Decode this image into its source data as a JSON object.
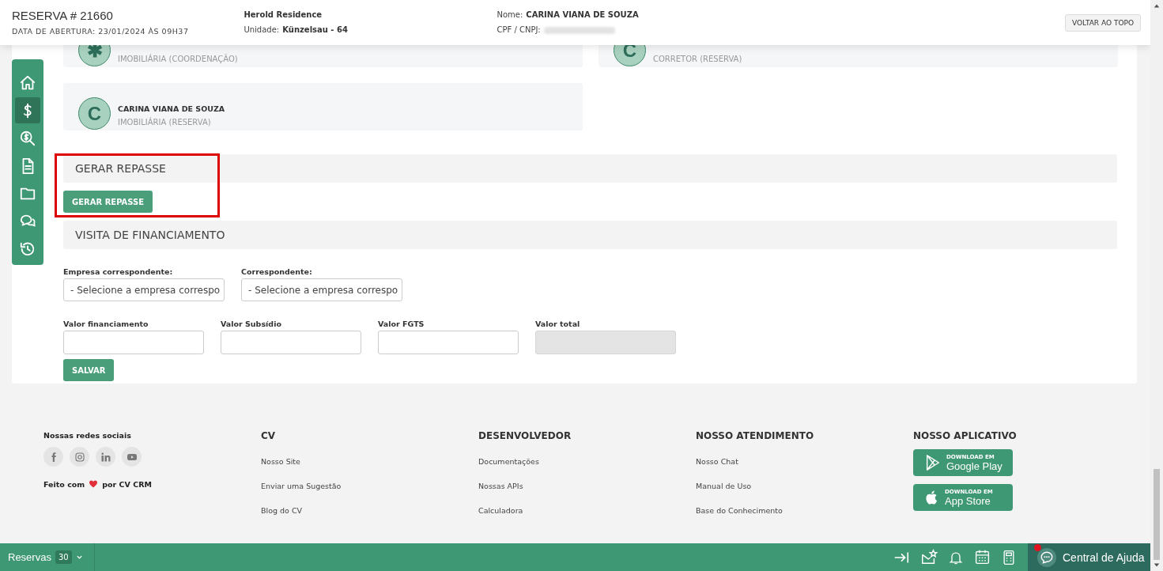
{
  "header": {
    "title": "RESERVA # 21660",
    "opened": "DATA DE ABERTURA: 23/01/2024 ÀS 09H37",
    "project": "Herold Residence",
    "unit_label": "Unidade:",
    "unit": "Künzelsau - 64",
    "name_label": "Nome:",
    "name": "CARINA VIANA DE SOUZA",
    "cpf_label": "CPF / CNPJ:",
    "back_button": "VOLTAR AO TOPO"
  },
  "sidebar": {
    "items": [
      {
        "kind": "home",
        "selected": false
      },
      {
        "kind": "dollar",
        "selected": true
      },
      {
        "kind": "search-dollar",
        "selected": false
      },
      {
        "kind": "document",
        "selected": false
      },
      {
        "kind": "folder",
        "selected": false
      },
      {
        "kind": "chat",
        "selected": false
      },
      {
        "kind": "history",
        "selected": false
      }
    ]
  },
  "people": [
    {
      "initial": "✱",
      "role": "IMOBILIÁRIA (COORDENAÇÃO)"
    },
    {
      "initial": "C",
      "role": "CORRETOR (RESERVA)"
    },
    {
      "initial": "C",
      "name": "CARINA VIANA DE SOUZA",
      "role": "IMOBILIÁRIA (RESERVA)"
    }
  ],
  "gerar_repasse": {
    "title": "GERAR REPASSE",
    "button": "GERAR REPASSE",
    "highlighted": true
  },
  "visita": {
    "title": "VISITA DE FINANCIAMENTO",
    "selects": [
      {
        "label": "Empresa correspondente:",
        "value": "- Selecione a empresa correspo"
      },
      {
        "label": "Correspondente:",
        "value": "- Selecione a empresa correspo"
      }
    ],
    "inputs": [
      {
        "label": "Valor financiamento",
        "disabled": false
      },
      {
        "label": "Valor Subsídio",
        "disabled": false
      },
      {
        "label": "Valor FGTS",
        "disabled": false
      },
      {
        "label": "Valor total",
        "disabled": true
      }
    ],
    "save": "SALVAR"
  },
  "footer": {
    "social_title": "Nossas redes sociais",
    "social": [
      {
        "kind": "facebook"
      },
      {
        "kind": "instagram"
      },
      {
        "kind": "linkedin"
      },
      {
        "kind": "youtube"
      }
    ],
    "made_with": "Feito com",
    "made_by": "por CV CRM",
    "columns": [
      {
        "title": "CV",
        "links": [
          "Nosso Site",
          "Enviar uma Sugestão",
          "Blog do CV"
        ]
      },
      {
        "title": "DESENVOLVEDOR",
        "links": [
          "Documentações",
          "Nossas APIs",
          "Calculadora"
        ]
      },
      {
        "title": "NOSSO ATENDIMENTO",
        "links": [
          "Nosso Chat",
          "Manual de Uso",
          "Base do Conhecimento"
        ]
      }
    ],
    "app_title": "NOSSO APLICATIVO",
    "stores": [
      {
        "kind": "google",
        "small": "DOWNLOAD EM",
        "name": "Google Play"
      },
      {
        "kind": "apple",
        "small": "DOWNLOAD EM",
        "name": "App Store"
      }
    ]
  },
  "bottom_bar": {
    "label": "Reservas",
    "count": "30",
    "help": "Central de Ajuda",
    "help_notification": true
  }
}
